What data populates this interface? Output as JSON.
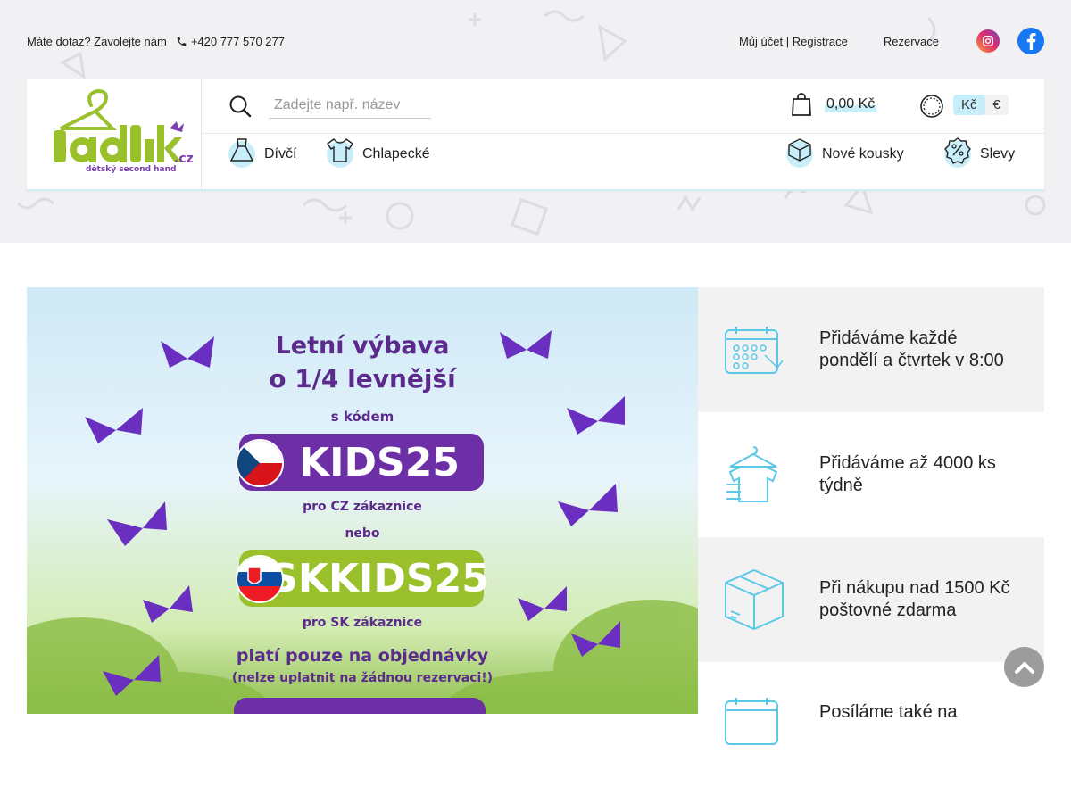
{
  "topbar": {
    "contact_label": "Máte dotaz? Zavolejte nám",
    "phone": "+420 777 570 277",
    "account_label": "Můj účet",
    "separator": "|",
    "register_label": "Registrace",
    "reservation_label": "Rezervace"
  },
  "logo": {
    "main": "Jadlik",
    "domain": ".cz",
    "tagline": "dětský second hand"
  },
  "search": {
    "placeholder": "Zadejte např. název"
  },
  "cart": {
    "total": "0,00 Kč"
  },
  "currency": {
    "options": [
      "Kč",
      "€"
    ],
    "selected": "Kč"
  },
  "nav": {
    "girls": "Dívčí",
    "boys": "Chlapecké",
    "new": "Nové kousky",
    "sale": "Slevy"
  },
  "banner": {
    "line1": "Letní výbava",
    "line2": "o 1/4 levnější",
    "with_code": "s kódem",
    "code_cz": "KIDS25",
    "for_cz": "pro CZ zákaznice",
    "or": "nebo",
    "code_sk": "SKKIDS25",
    "for_sk": "pro SK zákaznice",
    "valid": "platí pouze na objednávky",
    "note": "(nelze uplatnit na žádnou rezervaci!)"
  },
  "features": [
    {
      "text": "Přidáváme každé pondělí a čtvrtek v 8:00",
      "icon": "calendar-icon"
    },
    {
      "text": "Přidáváme až 4000 ks týdně",
      "icon": "clothes-stack-icon"
    },
    {
      "text": "Při nákupu nad 1500 Kč poštovné zdarma",
      "icon": "box-icon"
    },
    {
      "text": "Posíláme také na",
      "icon": "calendar-icon"
    }
  ],
  "colors": {
    "accent": "#c8eef9",
    "icon_blue": "#5bc8e8",
    "purple": "#5b2a8c",
    "green": "#9ac02c"
  }
}
